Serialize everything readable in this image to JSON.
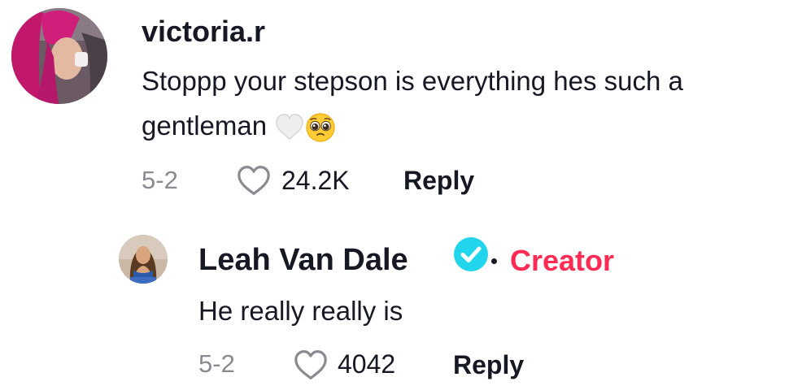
{
  "comment": {
    "username": "victoria.r",
    "text": "Stoppp your stepson is everything hes such a gentleman",
    "emojis": [
      "white-heart",
      "pleading-face"
    ],
    "date": "5-2",
    "likes": "24.2K",
    "reply_label": "Reply"
  },
  "reply": {
    "username": "Leah Van Dale",
    "verified": true,
    "badge": "Creator",
    "text": "He really really is",
    "date": "5-2",
    "likes": "4042",
    "reply_label": "Reply"
  },
  "colors": {
    "text_primary": "#161823",
    "text_secondary": "#8a8b91",
    "creator_accent": "#fe2c55",
    "verified_badge": "#20d5ec"
  }
}
